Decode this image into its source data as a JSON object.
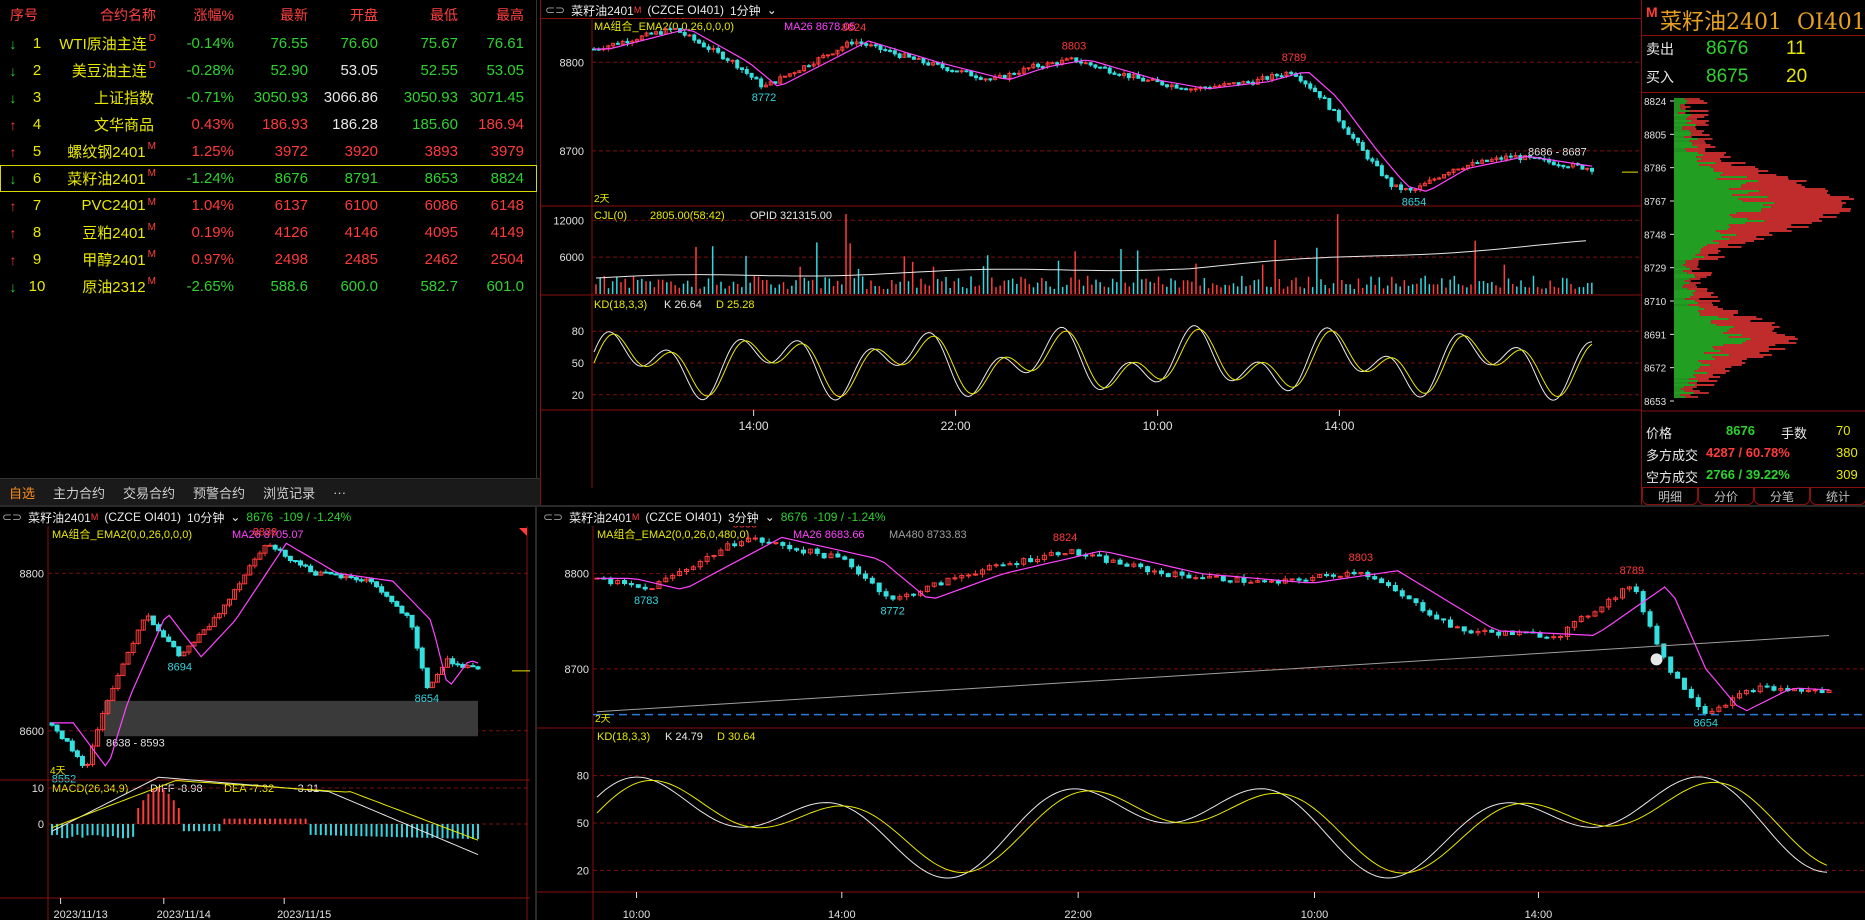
{
  "quote": {
    "headers": [
      "序号",
      "合约名称",
      "涨幅%",
      "最新",
      "开盘",
      "最低",
      "最高"
    ],
    "rows": [
      {
        "no": "1",
        "name": "WTI原油主连",
        "tag": "D",
        "chg": "-0.14%",
        "last": "76.55",
        "open": "76.60",
        "low": "75.67",
        "high": "76.61",
        "dir": "down"
      },
      {
        "no": "2",
        "name": "美豆油主连",
        "tag": "D",
        "chg": "-0.28%",
        "last": "52.90",
        "open": "53.05",
        "low": "52.55",
        "high": "53.05",
        "dir": "down"
      },
      {
        "no": "3",
        "name": "上证指数",
        "tag": "",
        "chg": "-0.71%",
        "last": "3050.93",
        "open": "3066.86",
        "low": "3050.93",
        "high": "3071.45",
        "dir": "down"
      },
      {
        "no": "4",
        "name": "文华商品",
        "tag": "",
        "chg": "0.43%",
        "last": "186.93",
        "open": "186.28",
        "low": "185.60",
        "high": "186.94",
        "dir": "up"
      },
      {
        "no": "5",
        "name": "螺纹钢2401",
        "tag": "M",
        "chg": "1.25%",
        "last": "3972",
        "open": "3920",
        "low": "3893",
        "high": "3979",
        "dir": "up"
      },
      {
        "no": "6",
        "name": "菜籽油2401",
        "tag": "M",
        "chg": "-1.24%",
        "last": "8676",
        "open": "8791",
        "low": "8653",
        "high": "8824",
        "dir": "down"
      },
      {
        "no": "7",
        "name": "PVC2401",
        "tag": "M",
        "chg": "1.04%",
        "last": "6137",
        "open": "6100",
        "low": "6086",
        "high": "6148",
        "dir": "up"
      },
      {
        "no": "8",
        "name": "豆粕2401",
        "tag": "M",
        "chg": "0.19%",
        "last": "4126",
        "open": "4146",
        "low": "4095",
        "high": "4149",
        "dir": "up"
      },
      {
        "no": "9",
        "name": "甲醇2401",
        "tag": "M",
        "chg": "0.97%",
        "last": "2498",
        "open": "2485",
        "low": "2462",
        "high": "2504",
        "dir": "up"
      },
      {
        "no": "10",
        "name": "原油2312",
        "tag": "M",
        "chg": "-2.65%",
        "last": "588.6",
        "open": "600.0",
        "low": "582.7",
        "high": "601.0",
        "dir": "down"
      }
    ],
    "tabs": [
      "自选",
      "主力合约",
      "交易合约",
      "预警合约",
      "浏览记录",
      "···"
    ]
  },
  "top": {
    "symbol": "菜籽油2401",
    "sup": "M",
    "code": "(CZCE OI401)",
    "period": "1分钟",
    "ma_label": "MA组合_EMA2(0,0,26,0,0,0)",
    "ma26": "MA26 8678.05",
    "yticks": [
      "8800",
      "8700"
    ],
    "peaks": [
      "8838",
      "8824",
      "8803",
      "8789"
    ],
    "troughs": [
      "8772",
      "8654"
    ],
    "range": "8686 - 8687",
    "days": "2天",
    "vol_label": "CJL(0)",
    "vol_vals": "2805.00(58:42)",
    "opid": "OPID 321315.00",
    "vol_ticks": [
      "12000",
      "6000"
    ],
    "kd_label": "KD(18,3,3)",
    "kd_k": "K 26.64",
    "kd_d": "D 25.28",
    "kd_ticks": [
      "80",
      "50",
      "20"
    ],
    "xticks": [
      "14:00",
      "22:00",
      "10:00",
      "14:00"
    ]
  },
  "side": {
    "m": "M",
    "name": "菜籽油2401",
    "code": "OI401",
    "sell_lbl": "卖出",
    "sell_px": "8676",
    "sell_qty": "11",
    "buy_lbl": "买入",
    "buy_px": "8675",
    "buy_qty": "20",
    "prices": [
      "8824",
      "8805",
      "8786",
      "8767",
      "8748",
      "8729",
      "8710",
      "8691",
      "8672",
      "8653"
    ],
    "price_lbl": "价格",
    "price_val": "8676",
    "hands_lbl": "手数",
    "hands_val": "70",
    "long_lbl": "多方成交",
    "long_val": "4287 / 60.78%",
    "long_n": "380",
    "short_lbl": "空方成交",
    "short_val": "2766 / 39.22%",
    "short_n": "309",
    "tabs": [
      "明细",
      "分价",
      "分笔",
      "统计"
    ]
  },
  "bl": {
    "symbol": "菜籽油2401",
    "sup": "M",
    "code": "(CZCE OI401)",
    "period": "10分钟",
    "last": "8676",
    "chg": "-109 / -1.24%",
    "ma_label": "MA组合_EMA2(0,0,26,0,0,0)",
    "ma26": "MA26 8705.07",
    "yticks": [
      "8800",
      "8600"
    ],
    "peak": "8838",
    "t1": "8694",
    "t2": "8654",
    "t3": "8552",
    "range": "8638 - 8593",
    "days": "4天",
    "macd_label": "MACD(26,34,9)",
    "diff": "DIFF -8.98",
    "dea": "DEA -7.32",
    "macd": "-3.31",
    "macd_ticks": [
      "10",
      "0"
    ],
    "xticks": [
      "2023/11/13",
      "2023/11/14",
      "2023/11/15"
    ]
  },
  "br": {
    "symbol": "菜籽油2401",
    "sup": "M",
    "code": "(CZCE OI401)",
    "period": "3分钟",
    "last": "8676",
    "chg": "-109 / -1.24%",
    "ma_label": "MA组合_EMA2(0,0,26,0,480,0)",
    "ma26": "MA26 8683.66",
    "ma480": "MA480 8733.83",
    "yticks": [
      "8800",
      "8700"
    ],
    "peaks": [
      "8838",
      "8824",
      "8803",
      "8789"
    ],
    "troughs": [
      "8783",
      "8772",
      "8654"
    ],
    "days": "2天",
    "kd_label": "KD(18,3,3)",
    "kd_k": "K 24.79",
    "kd_d": "D 30.64",
    "kd_ticks": [
      "80",
      "50",
      "20"
    ],
    "xticks": [
      "10:00",
      "14:00",
      "22:00",
      "10:00",
      "14:00"
    ]
  },
  "colors": {
    "up": "#ff3b3b",
    "down": "#2ed22e",
    "cyan": "#33d6e0",
    "magenta": "#ff44ff",
    "yellow": "#e8e800",
    "grid": "#8a1010"
  }
}
